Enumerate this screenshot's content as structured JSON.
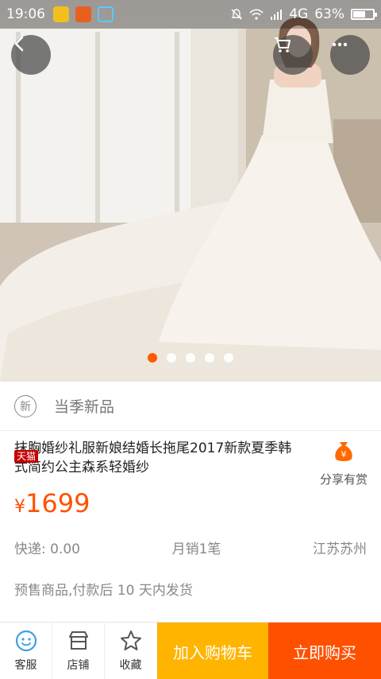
{
  "status_bar": {
    "time": "19:06",
    "network": "4G",
    "battery_percent": "63%",
    "battery_level": 0.63
  },
  "gallery": {
    "dot_count": 5,
    "active_index": 0,
    "accent_color": "#ff5a00"
  },
  "season": {
    "badge_text": "新",
    "label": "当季新品"
  },
  "product": {
    "badge": "天猫",
    "title": "抹胸婚纱礼服新娘结婚长拖尾2017新款夏季韩式简约公主森系轻婚纱",
    "currency": "¥",
    "price": "1699",
    "shipping": "快递: 0.00",
    "monthly_sales": "月销1笔",
    "location": "江苏苏州",
    "presale_note": "预售商品,付款后 10 天内发货"
  },
  "share": {
    "label": "分享有赏"
  },
  "bottom_bar": {
    "service_label": "客服",
    "shop_label": "店铺",
    "favorite_label": "收藏",
    "add_to_cart_label": "加入购物车",
    "buy_now_label": "立即购买",
    "cart_color": "#ffb400",
    "buy_color": "#ff5000"
  },
  "icons": {
    "back": "back-icon",
    "cart": "cart-icon",
    "more": "more-icon",
    "service": "service-icon",
    "shop": "shop-icon",
    "favorite": "star-icon",
    "share": "money-bag-icon"
  }
}
